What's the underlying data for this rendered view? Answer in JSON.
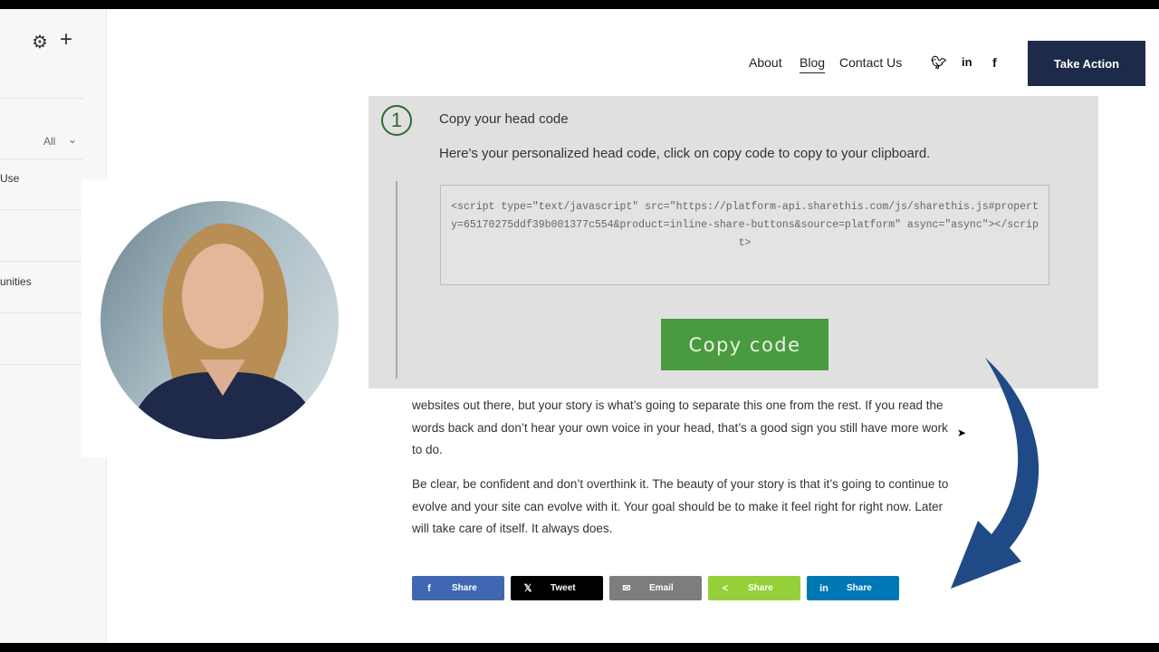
{
  "sidebar": {
    "filter_value": "All",
    "items": [
      "Use",
      "",
      "unities",
      ""
    ]
  },
  "nav": {
    "links": [
      "About",
      "Blog",
      "Contact Us"
    ],
    "active": "Blog",
    "social": [
      "twitter-icon",
      "linkedin-icon",
      "facebook-icon"
    ],
    "cta": "Take Action"
  },
  "panel": {
    "step": "1",
    "title": "Copy your head code",
    "subtitle": "Here's your personalized head code, click on copy code to copy to your clipboard.",
    "code": "<script type=\"text/javascript\" src=\"https://platform-api.sharethis.com/js/sharethis.js#property=65170275ddf39b001377c554&product=inline-share-buttons&source=platform\" async=\"async\"></script>",
    "copy_label": "Copy code"
  },
  "article": {
    "p1": "websites out there, but your story is what’s going to separate this one from the rest. If you read the words back and don’t hear your own voice in your head, that’s a good sign you still have more work to do.",
    "p2": "Be clear, be confident and don’t overthink it. The beauty of your story is that it’s going to continue to evolve and your site can evolve with it. Your goal should be to make it feel right for right now. Later will take care of itself. It always does."
  },
  "share_buttons": [
    {
      "icon": "f",
      "label": "Share",
      "color": "#4267b2"
    },
    {
      "icon": "𝕏",
      "label": "Tweet",
      "color": "#000000"
    },
    {
      "icon": "✉",
      "label": "Email",
      "color": "#7d7d7d"
    },
    {
      "icon": "<",
      "label": "Share",
      "color": "#95d03a"
    },
    {
      "icon": "in",
      "label": "Share",
      "color": "#0077b5"
    }
  ],
  "colors": {
    "cta": "#1e2a4a",
    "copy_button": "#4a9a3f",
    "arrow": "#1f4a86"
  }
}
